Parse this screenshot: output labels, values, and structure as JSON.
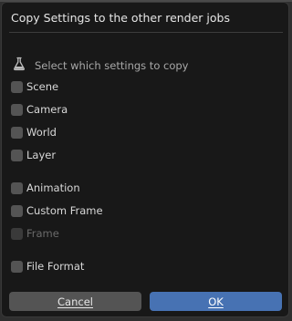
{
  "dialog": {
    "title": "Copy Settings to the other render jobs",
    "subheading_icon": "flask-icon",
    "subheading": "Select which settings to copy"
  },
  "options": {
    "scene": {
      "label": "Scene",
      "checked": false,
      "enabled": true
    },
    "camera": {
      "label": "Camera",
      "checked": false,
      "enabled": true
    },
    "world": {
      "label": "World",
      "checked": false,
      "enabled": true
    },
    "layer": {
      "label": "Layer",
      "checked": false,
      "enabled": true
    },
    "animation": {
      "label": "Animation",
      "checked": false,
      "enabled": true
    },
    "custom_frame": {
      "label": "Custom Frame",
      "checked": false,
      "enabled": true
    },
    "frame": {
      "label": "Frame",
      "checked": false,
      "enabled": false
    },
    "file_format": {
      "label": "File Format",
      "checked": false,
      "enabled": true
    }
  },
  "buttons": {
    "cancel": "Cancel",
    "ok": "OK"
  },
  "colors": {
    "dialog_bg": "#181818",
    "checkbox": "#545454",
    "ok_accent": "#4772b3",
    "cancel_bg": "#545454"
  }
}
